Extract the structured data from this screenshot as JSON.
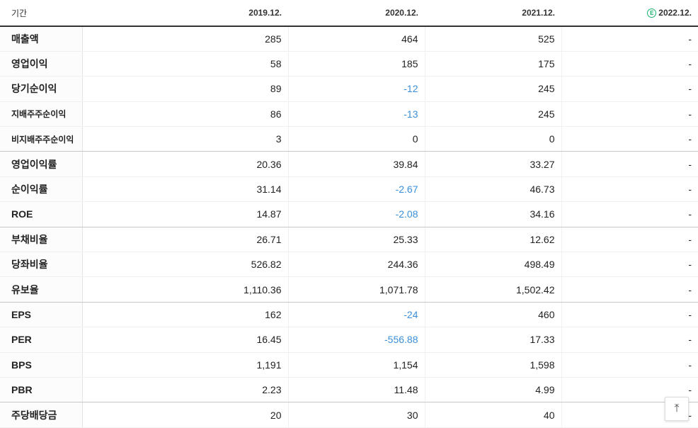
{
  "header": {
    "period_label": "기간",
    "periods": [
      "2019.12.",
      "2020.12.",
      "2021.12.",
      "2022.12."
    ],
    "estimate_badge": "E"
  },
  "rows": [
    {
      "label": "매출액",
      "values": [
        "285",
        "464",
        "525",
        "-"
      ]
    },
    {
      "label": "영업이익",
      "values": [
        "58",
        "185",
        "175",
        "-"
      ]
    },
    {
      "label": "당기순이익",
      "values": [
        "89",
        "-12",
        "245",
        "-"
      ]
    },
    {
      "label": "지배주주순이익",
      "values": [
        "86",
        "-13",
        "245",
        "-"
      ]
    },
    {
      "label": "비지배주주순이익",
      "values": [
        "3",
        "0",
        "0",
        "-"
      ]
    },
    {
      "label": "영업이익률",
      "values": [
        "20.36",
        "39.84",
        "33.27",
        "-"
      ]
    },
    {
      "label": "순이익률",
      "values": [
        "31.14",
        "-2.67",
        "46.73",
        "-"
      ]
    },
    {
      "label": "ROE",
      "values": [
        "14.87",
        "-2.08",
        "34.16",
        "-"
      ]
    },
    {
      "label": "부채비율",
      "values": [
        "26.71",
        "25.33",
        "12.62",
        "-"
      ]
    },
    {
      "label": "당좌비율",
      "values": [
        "526.82",
        "244.36",
        "498.49",
        "-"
      ]
    },
    {
      "label": "유보율",
      "values": [
        "1,110.36",
        "1,071.78",
        "1,502.42",
        "-"
      ]
    },
    {
      "label": "EPS",
      "values": [
        "162",
        "-24",
        "460",
        "-"
      ]
    },
    {
      "label": "PER",
      "values": [
        "16.45",
        "-556.88",
        "17.33",
        "-"
      ]
    },
    {
      "label": "BPS",
      "values": [
        "1,191",
        "1,154",
        "1,598",
        "-"
      ]
    },
    {
      "label": "PBR",
      "values": [
        "2.23",
        "11.48",
        "4.99",
        "-"
      ]
    },
    {
      "label": "주당배당금",
      "values": [
        "20",
        "30",
        "40",
        "-"
      ]
    }
  ],
  "colors": {
    "negative": "#3a8fd8",
    "estimate": "#19b36b"
  },
  "scroll_top_icon": "arrow-up-icon"
}
